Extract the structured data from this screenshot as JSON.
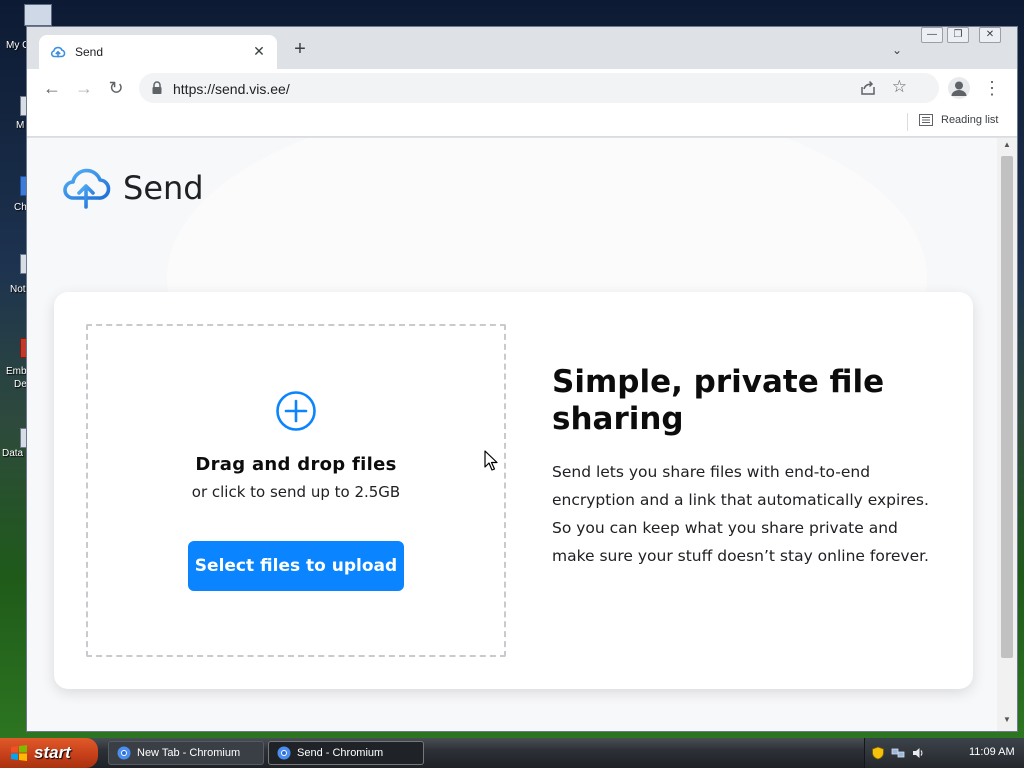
{
  "desktop": {
    "icons": [
      {
        "label": "My C"
      },
      {
        "label": "M"
      },
      {
        "label": "Ch"
      },
      {
        "label": "Not"
      },
      {
        "label": "Emb"
      },
      {
        "label": "De"
      },
      {
        "label": "Data"
      }
    ]
  },
  "browser": {
    "tab": {
      "title": "Send",
      "favicon": "send-cloud-icon",
      "close_label": "✕"
    },
    "new_tab_label": "+",
    "tab_search_label": "⌄",
    "window_controls": {
      "minimize": "—",
      "maximize": "❐",
      "close": "✕"
    },
    "toolbar": {
      "back": "←",
      "forward": "→",
      "reload": "↻",
      "url": "https://send.vis.ee/",
      "bookmark_star": "☆",
      "menu": "⋮"
    },
    "bookmarks_bar": {
      "reading_list_label": "Reading list"
    }
  },
  "page": {
    "brand_name": "Send",
    "dropzone": {
      "title": "Drag and drop files",
      "subtitle": "or click to send up to 2.5GB",
      "button_label": "Select files to upload"
    },
    "intro": {
      "heading": "Simple, private file sharing",
      "body": "Send lets you share files with end-to-end encryption and a link that automatically expires. So you can keep what you share private and make sure your stuff doesn’t stay online forever."
    },
    "accent_color": "#0a84ff"
  },
  "taskbar": {
    "start_label": "start",
    "tasks": [
      {
        "label": "New Tab - Chromium",
        "active": false
      },
      {
        "label": "Send - Chromium",
        "active": true
      }
    ],
    "clock": "11:09 AM"
  }
}
